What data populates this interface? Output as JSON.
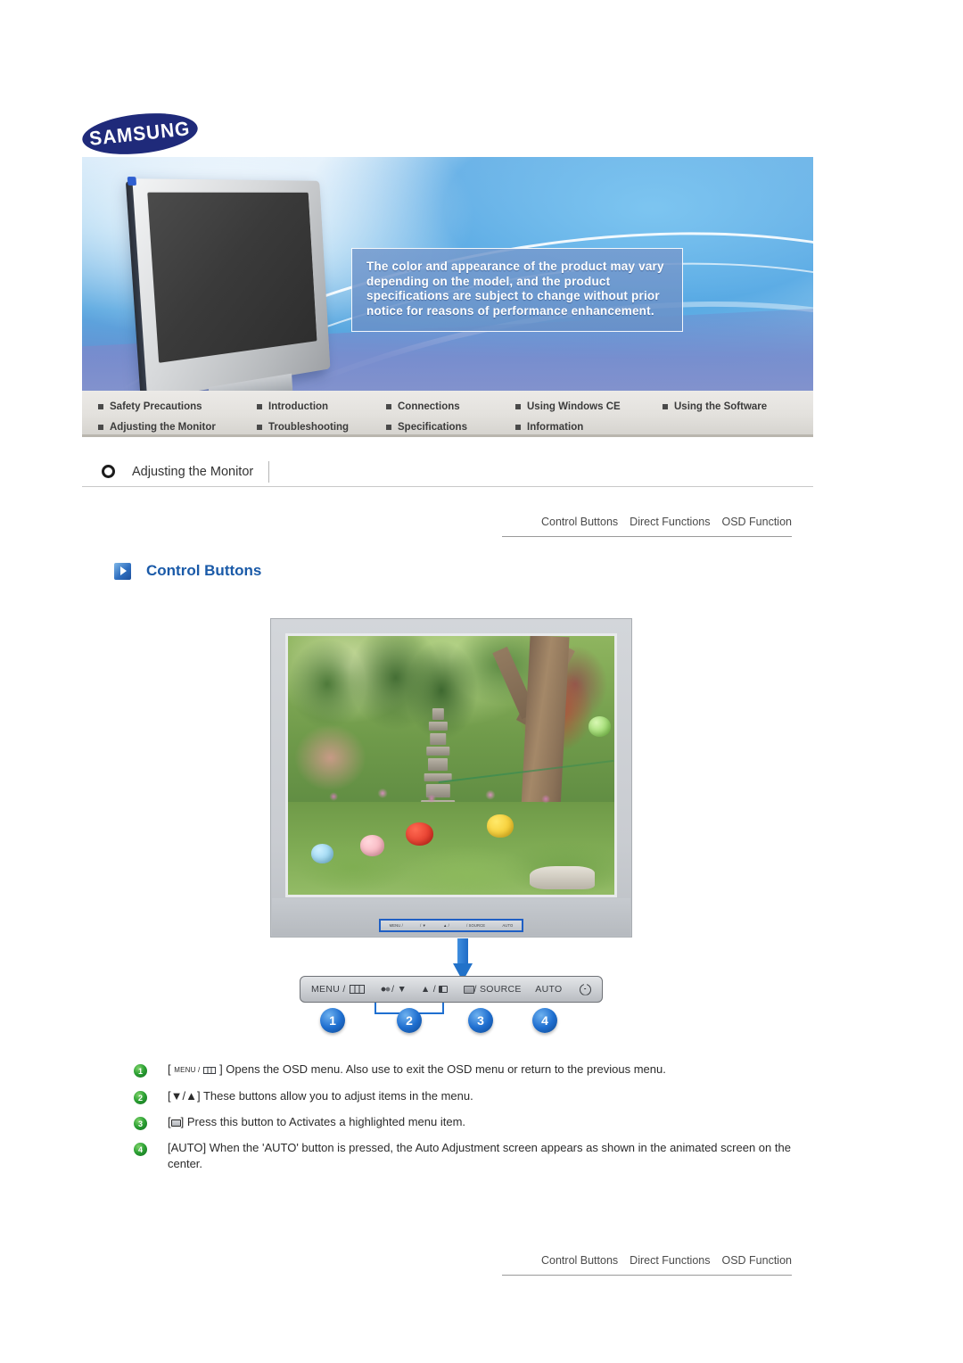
{
  "brand": {
    "logo_text": "SAMSUNG"
  },
  "hero": {
    "notice": "The color and appearance of the product may vary depending on the model, and the product specifications are subject to change without prior notice for reasons of performance enhancement."
  },
  "nav": {
    "row1": [
      {
        "label": "Safety Precautions"
      },
      {
        "label": "Introduction"
      },
      {
        "label": "Connections"
      },
      {
        "label": "Using Windows CE"
      },
      {
        "label": "Using the Software"
      }
    ],
    "row2": [
      {
        "label": "Adjusting the Monitor"
      },
      {
        "label": "Troubleshooting"
      },
      {
        "label": "Specifications"
      },
      {
        "label": "Information"
      }
    ]
  },
  "section": {
    "title": "Adjusting the Monitor"
  },
  "crumbs": [
    {
      "label": "Control Buttons"
    },
    {
      "label": "Direct Functions"
    },
    {
      "label": "OSD Function"
    }
  ],
  "heading": {
    "text": "Control Buttons",
    "icon": "play-arrow-icon"
  },
  "monitor_panel": {
    "small_strip": [
      {
        "label": "MENU /"
      },
      {
        "label": "/ ▼"
      },
      {
        "label": "▲ /"
      },
      {
        "label": "/ SOURCE"
      },
      {
        "label": "AUTO"
      }
    ]
  },
  "button_strip": {
    "menu_label": "MENU /",
    "down_label": "/ ▼",
    "up_label": "▲ /",
    "source_label": "/ SOURCE",
    "auto_label": "AUTO",
    "power_icon": "power-icon"
  },
  "callouts": [
    {
      "number": "1"
    },
    {
      "number": "2"
    },
    {
      "number": "3"
    },
    {
      "number": "4"
    }
  ],
  "descriptions": [
    {
      "number": "1",
      "prefix": "[",
      "menu_word": "MENU /",
      "text": "] Opens the OSD menu. Also use to exit the OSD menu or return to the previous menu."
    },
    {
      "number": "2",
      "text": "[▼/▲] These buttons allow you to adjust items in the menu."
    },
    {
      "number": "3",
      "prefix": "[",
      "text": "] Press this button to Activates a highlighted menu item."
    },
    {
      "number": "4",
      "text": "[AUTO] When the 'AUTO' button is pressed, the Auto Adjustment screen appears as shown in the animated screen on the center."
    }
  ],
  "colors": {
    "brand_blue": "#1f2a7a",
    "heading_blue": "#1a5aa8",
    "badge_blue": "#1f6fd0",
    "badge_green": "#2ba033"
  }
}
